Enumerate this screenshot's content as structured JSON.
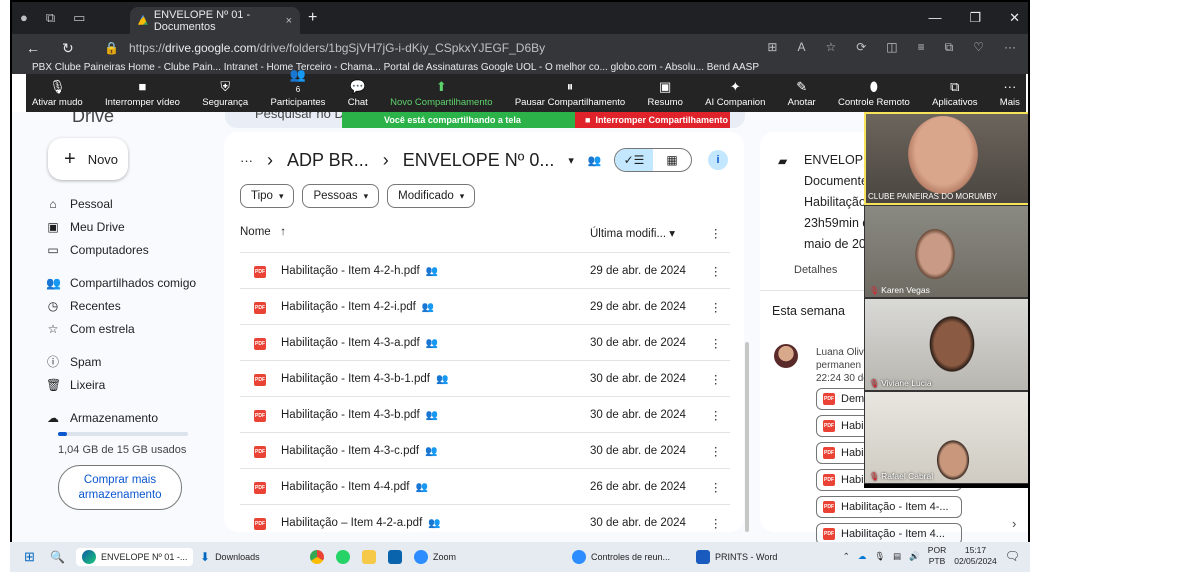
{
  "browser": {
    "tab_title": "ENVELOPE Nº 01 - Documentos",
    "tab_close": "×",
    "new_tab": "+",
    "url_prefix": "https://",
    "url_domain": "drive.google.com",
    "url_path": "/drive/folders/1bgSjVH7jG-i-dKiy_CSpkxYJEGF_D6By",
    "bookmarks": "PBX Clube Paineiras    Home - Clube Pain...    Intranet - Home    Terceiro - Chama...    Portal de Assinaturas    Google    UOL - O melhor co...    globo.com - Absolu...    Bend    AASP"
  },
  "zoom_toolbar": {
    "items": [
      {
        "icon": "mic-icon",
        "glyph": "🎙",
        "label": "Ativar mudo"
      },
      {
        "icon": "video-icon",
        "glyph": "■",
        "label": "Interromper vídeo"
      },
      {
        "icon": "shield-icon",
        "glyph": "⛨",
        "label": "Segurança"
      },
      {
        "icon": "participants-icon",
        "glyph": "👥",
        "label": "Participantes",
        "count": "6"
      },
      {
        "icon": "chat-icon",
        "glyph": "💬",
        "label": "Chat"
      },
      {
        "icon": "share-icon",
        "glyph": "⬆",
        "label": "Novo Compartilhamento"
      },
      {
        "icon": "pause-icon",
        "glyph": "⏸",
        "label": "Pausar Compartilhamento"
      },
      {
        "icon": "summary-icon",
        "glyph": "▣",
        "label": "Resumo"
      },
      {
        "icon": "ai-companion-icon",
        "glyph": "✦",
        "label": "AI Companion"
      },
      {
        "icon": "annotate-icon",
        "glyph": "✎",
        "label": "Anotar"
      },
      {
        "icon": "remote-control-icon",
        "glyph": "⬮",
        "label": "Controle Remoto"
      },
      {
        "icon": "apps-icon",
        "glyph": "⧉",
        "label": "Aplicativos"
      },
      {
        "icon": "more-icon",
        "glyph": "···",
        "label": "Mais"
      }
    ],
    "sharing_text": "Você está compartilhando a tela",
    "stop_sharing": "Interromper Compartilhamento"
  },
  "drive": {
    "logo_text": "Drive",
    "search_placeholder": "Pesquisar no Drive",
    "new_button": "Novo",
    "nav": [
      {
        "icon": "home-icon",
        "glyph": "⌂",
        "label": "Pessoal"
      },
      {
        "icon": "my-drive-icon",
        "glyph": "▣",
        "label": "Meu Drive"
      },
      {
        "icon": "computers-icon",
        "glyph": "▭",
        "label": "Computadores"
      },
      {
        "icon": "shared-icon",
        "glyph": "👥",
        "label": "Compartilhados comigo"
      },
      {
        "icon": "recent-icon",
        "glyph": "◷",
        "label": "Recentes"
      },
      {
        "icon": "star-icon",
        "glyph": "☆",
        "label": "Com estrela"
      },
      {
        "icon": "spam-icon",
        "glyph": "ⓘ",
        "label": "Spam"
      },
      {
        "icon": "trash-icon",
        "glyph": "🗑",
        "label": "Lixeira"
      },
      {
        "icon": "cloud-icon",
        "glyph": "☁",
        "label": "Armazenamento"
      }
    ],
    "storage_text": "1,04 GB de 15 GB usados",
    "storage_fraction": 0.07,
    "buy_button": "Comprar mais armazenamento",
    "breadcrumb": {
      "ellipsis": "···",
      "parent": "ADP BR...",
      "current": "ENVELOPE Nº 0..."
    },
    "filters": [
      "Tipo",
      "Pessoas",
      "Modificado"
    ],
    "columns": {
      "name": "Nome",
      "modified": "Última modifi..."
    },
    "files": [
      {
        "name": "Habilitação - Item 4-2-h.pdf",
        "modified": "29 de abr. de 2024"
      },
      {
        "name": "Habilitação - Item 4-2-i.pdf",
        "modified": "29 de abr. de 2024"
      },
      {
        "name": "Habilitação - Item 4-3-a.pdf",
        "modified": "30 de abr. de 2024"
      },
      {
        "name": "Habilitação - Item 4-3-b-1.pdf",
        "modified": "30 de abr. de 2024"
      },
      {
        "name": "Habilitação - Item 4-3-b.pdf",
        "modified": "30 de abr. de 2024"
      },
      {
        "name": "Habilitação - Item 4-3-c.pdf",
        "modified": "30 de abr. de 2024"
      },
      {
        "name": "Habilitação - Item 4-4.pdf",
        "modified": "26 de abr. de 2024"
      },
      {
        "name": "Habilitação – Item 4-2-a.pdf",
        "modified": "30 de abr. de 2024"
      }
    ]
  },
  "details": {
    "title_lines": [
      "ENVELOPE",
      "Documente",
      "Habilitação",
      "23h59min d",
      "maio de 20"
    ],
    "tab": "Detalhes",
    "week": "Esta semana",
    "activity_lines": [
      "Luana Olivi",
      "permanen",
      "22:24 30 de"
    ],
    "chips": [
      "Dem",
      "Habil",
      "Habi",
      "Habi",
      "Habilitação - Item 4-...",
      "Habilitação - Item 4..."
    ]
  },
  "participants": [
    {
      "name": "CLUBE PAINEIRAS DO MORUMBY"
    },
    {
      "name": "Karen Vegas"
    },
    {
      "name": "Viviane Lucia"
    },
    {
      "name": "Rafael Cabral"
    }
  ],
  "taskbar": {
    "items": [
      "ENVELOPE Nº 01 -...",
      "Downloads",
      "Zoom",
      "Controles de reun...",
      "PRINTS - Word"
    ],
    "lang1": "POR",
    "lang2": "PTB",
    "time": "15:17",
    "date": "02/05/2024"
  }
}
